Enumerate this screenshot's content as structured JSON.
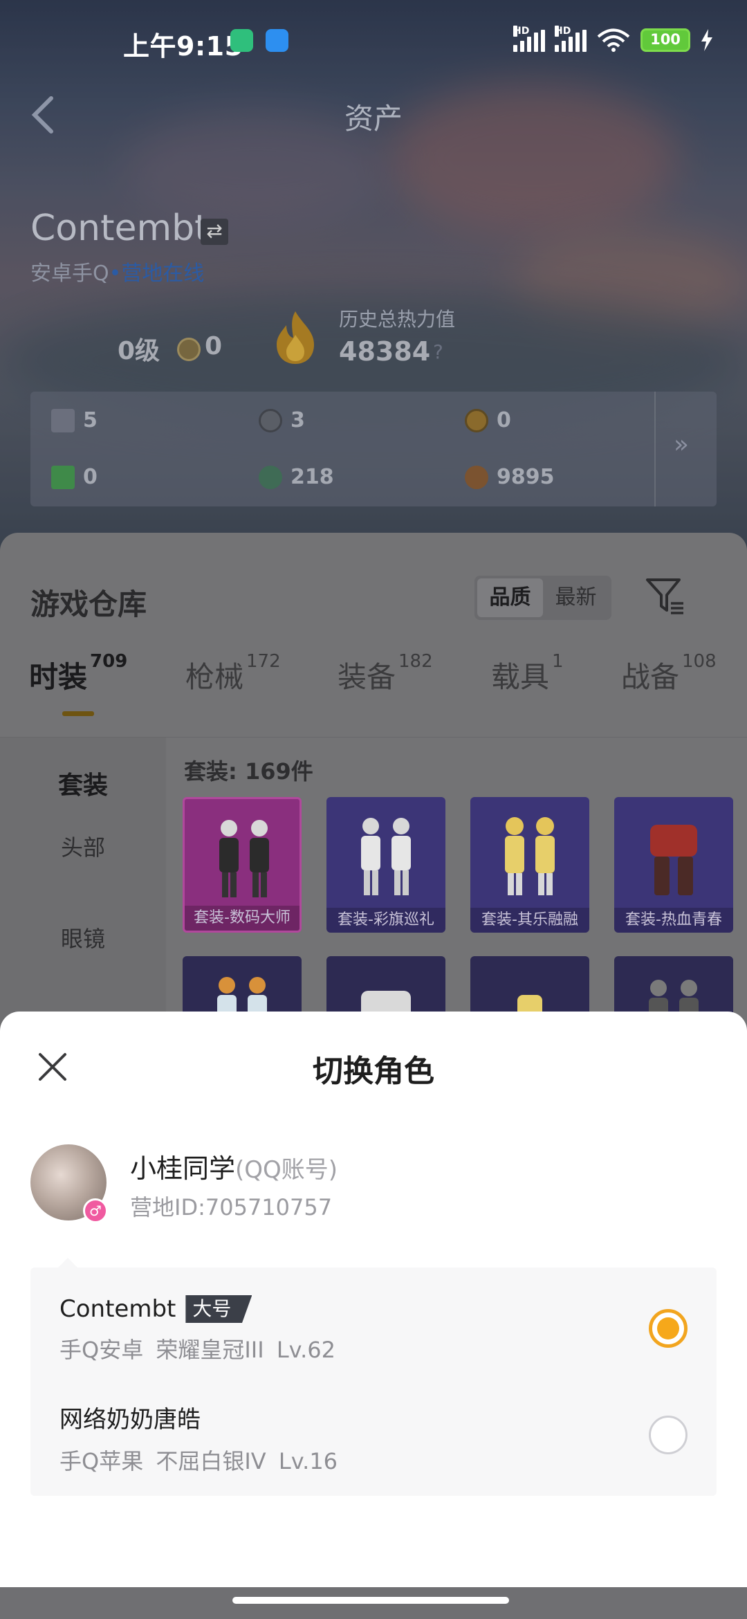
{
  "status_bar": {
    "time": "上午9:15",
    "signal1_label": "HD",
    "signal2_label": "HD",
    "battery": "100"
  },
  "header": {
    "title": "资产"
  },
  "profile": {
    "name": "Contembt",
    "platform": "安卓手Q",
    "online_status": "营地在线",
    "level": "0级",
    "rank_points": "0",
    "heat_label": "历史总热力值",
    "heat_value": "48384",
    "heat_help": "?"
  },
  "resources": [
    {
      "value": "5",
      "color": "#6b6f7d"
    },
    {
      "value": "3",
      "color": "#5a5e66"
    },
    {
      "value": "0",
      "color": "#8a6a2c"
    },
    {
      "value": "0",
      "color": "#3f8a49"
    },
    {
      "value": "218",
      "color": "#3f6b55"
    },
    {
      "value": "9895",
      "color": "#7b5330"
    }
  ],
  "resources_more": "»",
  "warehouse": {
    "title": "游戏仓库",
    "sort_options": [
      "品质",
      "最新"
    ],
    "sort_selected": "品质",
    "tabs": [
      {
        "label": "时装",
        "count": "709"
      },
      {
        "label": "枪械",
        "count": "172"
      },
      {
        "label": "装备",
        "count": "182"
      },
      {
        "label": "载具",
        "count": "1"
      },
      {
        "label": "战备",
        "count": "108"
      }
    ],
    "side_categories": [
      "套装",
      "头部",
      "眼镜"
    ],
    "set_count": "套装: 169件",
    "items": [
      {
        "caption": "套装-数码大师",
        "bg": "#8a2f7e"
      },
      {
        "caption": "套装-彩旗巡礼",
        "bg": "#3c3577"
      },
      {
        "caption": "套装-其乐融融",
        "bg": "#3c3577"
      },
      {
        "caption": "套装-热血青春",
        "bg": "#3c3577"
      },
      {
        "caption": "",
        "bg": "#2d2a52"
      },
      {
        "caption": "",
        "bg": "#2d2a52"
      },
      {
        "caption": "",
        "bg": "#2d2a52"
      },
      {
        "caption": "",
        "bg": "#2d2a52"
      }
    ]
  },
  "switch_sheet": {
    "title": "切换角色",
    "account_name": "小桂同学",
    "account_tag": "(QQ账号)",
    "camp_id": "营地ID:705710757",
    "roles": [
      {
        "name": "Contembt",
        "badge": "大号",
        "meta": "手Q安卓  荣耀皇冠III  Lv.62",
        "selected": true
      },
      {
        "name": "网络奶奶唐皓",
        "badge": "",
        "meta": "手Q苹果  不屈白银IV  Lv.16",
        "selected": false
      }
    ]
  },
  "colors": {
    "accent": "#f6a81a",
    "online": "#2b5ba4"
  }
}
